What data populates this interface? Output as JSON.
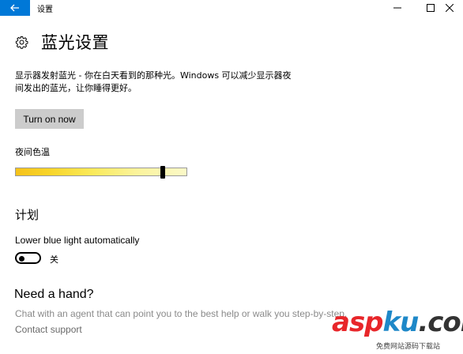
{
  "titlebar": {
    "title": "设置"
  },
  "header": {
    "title": "蓝光设置"
  },
  "description": "显示器发射蓝光 - 你在白天看到的那种光。Windows 可以减少显示器夜间发出的蓝光，让你睡得更好。",
  "turn_on_button": "Turn on now",
  "slider": {
    "label": "夜间色温",
    "value_fraction": 0.86
  },
  "schedule": {
    "heading": "计划",
    "toggle_label": "Lower blue light automatically",
    "toggle_state": "关"
  },
  "help": {
    "heading": "Need a hand?",
    "text": "Chat with an agent that can point you to the best help or walk you step-by-step.",
    "link": "Contact support"
  },
  "watermark": {
    "text": "aspku.com",
    "subtext": "免费网站源码下载站"
  },
  "colors": {
    "accent": "#0078d7",
    "button_bg": "#cccccc"
  }
}
